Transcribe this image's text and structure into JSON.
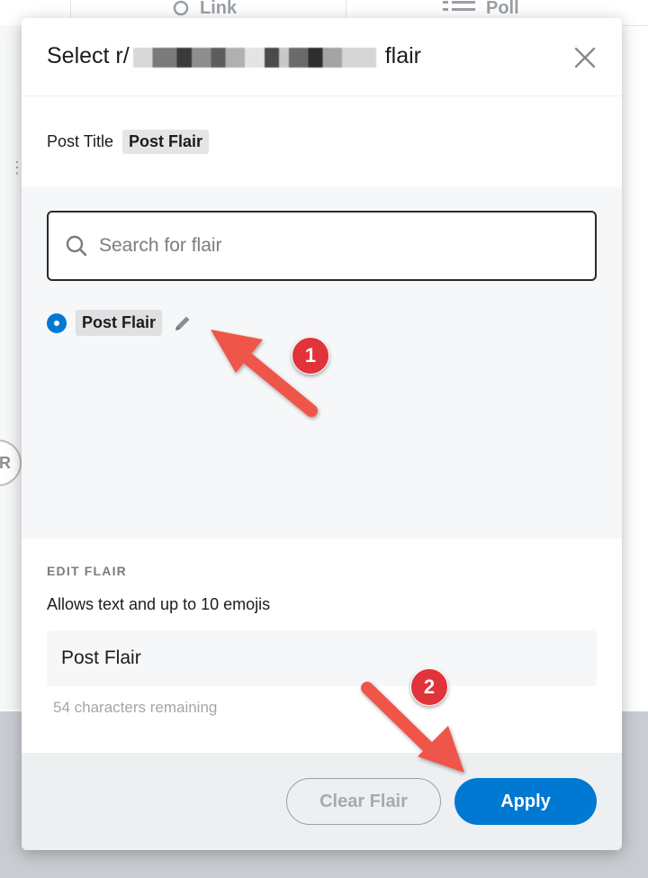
{
  "background": {
    "tabs": [
      {
        "label": "Link",
        "icon": "link-icon"
      },
      {
        "label": "Poll",
        "icon": "poll-icon"
      }
    ],
    "left_button_label": "ER"
  },
  "modal": {
    "title_prefix": "Select r/",
    "title_suffix": "flair",
    "close_icon": "close-icon",
    "preview": {
      "post_title": "Post Title",
      "flair_chip": "Post Flair"
    },
    "search": {
      "placeholder": "Search for flair",
      "value": ""
    },
    "flair_options": [
      {
        "label": "Post Flair",
        "selected": true
      }
    ],
    "edit": {
      "section_label": "EDIT FLAIR",
      "hint": "Allows text and up to 10 emojis",
      "value": "Post Flair",
      "remaining": "54 characters remaining"
    },
    "footer": {
      "clear_label": "Clear Flair",
      "apply_label": "Apply"
    }
  },
  "annotations": [
    {
      "number": "1"
    },
    {
      "number": "2"
    }
  ],
  "colors": {
    "accent_blue": "#0079d3",
    "annotation_red": "#e0333a",
    "arrow_red": "#f0544a"
  }
}
